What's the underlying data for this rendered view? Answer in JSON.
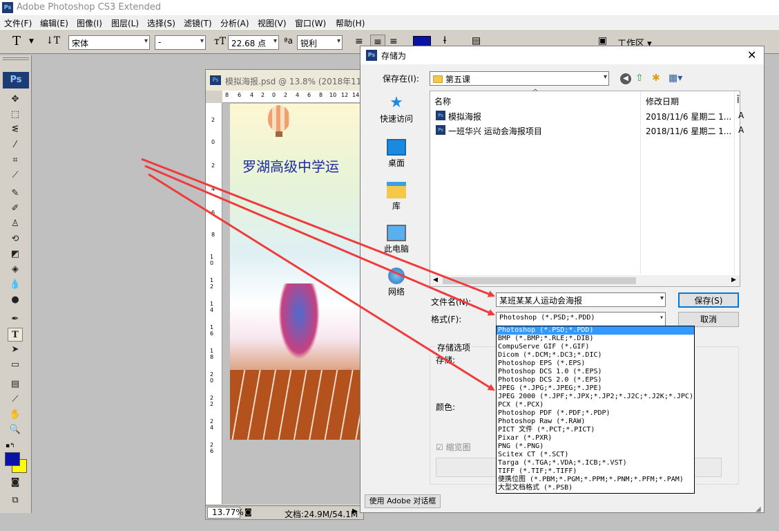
{
  "app": {
    "title": "Adobe Photoshop CS3 Extended",
    "logo": "Ps"
  },
  "menu": [
    "文件(F)",
    "编辑(E)",
    "图像(I)",
    "图层(L)",
    "选择(S)",
    "滤镜(T)",
    "分析(A)",
    "视图(V)",
    "窗口(W)",
    "帮助(H)"
  ],
  "options": {
    "font_family": "宋体",
    "font_style": "-",
    "font_size": "22.68 点",
    "aa_icon": "ªa",
    "antialias": "锐利",
    "workspace": "工作区"
  },
  "document": {
    "title": "模拟海报.psd @ 13.8% (2018年11月",
    "zoom": "13.77%",
    "doc_info": "文档:24.9M/54.1M",
    "poster_text": "罗湖高级中学运",
    "ruler_top": [
      "8",
      "6",
      "4",
      "2",
      "0",
      "2",
      "4",
      "6",
      "8",
      "10",
      "12",
      "14"
    ],
    "ruler_left": [
      "2",
      "0",
      "2",
      "4",
      "6",
      "8",
      "1 0",
      "1 2",
      "1 4",
      "1 6",
      "1 8",
      "2 0",
      "2 2",
      "2 4",
      "2 6"
    ]
  },
  "dialog": {
    "title": "存储为",
    "close": "✕",
    "save_in_label": "保存在(I):",
    "save_in_value": "第五课",
    "places": [
      "快速访问",
      "桌面",
      "库",
      "此电脑",
      "网络"
    ],
    "columns": {
      "name": "名称",
      "date": "修改日期",
      "extra": "Ī"
    },
    "files": [
      {
        "name": "模拟海报",
        "date": "2018/11/6 星期二 1...",
        "extra": "A"
      },
      {
        "name": "一班华兴  运动会海报项目",
        "date": "2018/11/6 星期二 1...",
        "extra": "A"
      }
    ],
    "filename_label": "文件名(N):",
    "filename_value": "某班某某人运动会海报",
    "format_label": "格式(F):",
    "format_value": "Photoshop (*.PSD;*.PDD)",
    "save_button": "保存(S)",
    "cancel_button": "取消",
    "save_options_label": "存储选项",
    "save_label_partial": "存储:",
    "color_label": "颜色:",
    "thumbnail_label": "缩览图",
    "use_adobe_dialog": "使用 Adobe 对话框",
    "formats": [
      "Photoshop (*.PSD;*.PDD)",
      "BMP (*.BMP;*.RLE;*.DIB)",
      "CompuServe GIF (*.GIF)",
      "Dicom (*.DCM;*.DC3;*.DIC)",
      "Photoshop EPS (*.EPS)",
      "Photoshop DCS 1.0 (*.EPS)",
      "Photoshop DCS 2.0 (*.EPS)",
      "JPEG (*.JPG;*.JPEG;*.JPE)",
      "JPEG 2000 (*.JPF;*.JPX;*.JP2;*.J2C;*.J2K;*.JPC)",
      "PCX (*.PCX)",
      "Photoshop PDF (*.PDF;*.PDP)",
      "Photoshop Raw (*.RAW)",
      "PICT 文件 (*.PCT;*.PICT)",
      "Pixar (*.PXR)",
      "PNG (*.PNG)",
      "Scitex CT (*.SCT)",
      "Targa (*.TGA;*.VDA;*.ICB;*.VST)",
      "TIFF (*.TIF;*.TIFF)",
      "便携位图 (*.PBM;*.PGM;*.PPM;*.PNM;*.PFM;*.PAM)",
      "大型文档格式 (*.PSB)"
    ]
  },
  "colors": {
    "foreground": "#0a12a8",
    "background": "#ffff00",
    "accent": "#3399ff",
    "arrow": "#ef3b3b"
  }
}
